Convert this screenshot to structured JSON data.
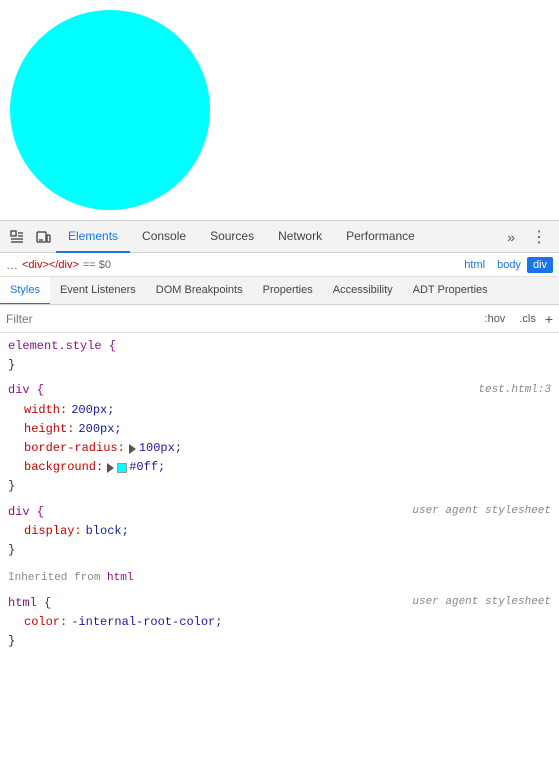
{
  "preview": {
    "circle_bg": "#00ffff"
  },
  "devtools": {
    "tabs": [
      {
        "label": "Elements",
        "active": true
      },
      {
        "label": "Console",
        "active": false
      },
      {
        "label": "Sources",
        "active": false
      },
      {
        "label": "Network",
        "active": false
      },
      {
        "label": "Performance",
        "active": false
      }
    ],
    "more_tabs_label": "»",
    "kebab_label": "⋮",
    "breadcrumb": {
      "dots": "…",
      "selected_text": "<div></div>",
      "eq_text": "== $0",
      "items": [
        "html",
        "body",
        "div"
      ]
    },
    "sub_tabs": [
      {
        "label": "Styles",
        "active": true
      },
      {
        "label": "Event Listeners",
        "active": false
      },
      {
        "label": "DOM Breakpoints",
        "active": false
      },
      {
        "label": "Properties",
        "active": false
      },
      {
        "label": "Accessibility",
        "active": false
      },
      {
        "label": "ADT Properties",
        "active": false
      }
    ],
    "filter": {
      "placeholder": "Filter",
      "hov_label": ":hov",
      "cls_label": ".cls",
      "plus_label": "+"
    },
    "css_rules": [
      {
        "id": "element-style",
        "selector": "element.style {",
        "close": "}",
        "properties": []
      },
      {
        "id": "div-rule",
        "selector": "div {",
        "source": "test.html:3",
        "close": "}",
        "properties": [
          {
            "prop": "width:",
            "value": "200px;"
          },
          {
            "prop": "height:",
            "value": "200px;"
          },
          {
            "prop": "border-radius:",
            "value": "▶ 100px;",
            "has_triangle": true
          },
          {
            "prop": "background:",
            "value": "#0ff;",
            "has_color": true,
            "color": "#00ffff"
          }
        ]
      },
      {
        "id": "div-ua-rule",
        "selector": "div {",
        "source": "user agent stylesheet",
        "close": "}",
        "properties": [
          {
            "prop": "display:",
            "value": "block;"
          }
        ]
      },
      {
        "id": "inherited-html",
        "is_inherited": true,
        "inherited_from": "html"
      },
      {
        "id": "html-rule",
        "selector": "html {",
        "source": "user agent stylesheet",
        "close": "}",
        "properties": [
          {
            "prop": "color:",
            "value": "-internal-root-color;"
          }
        ]
      }
    ]
  }
}
